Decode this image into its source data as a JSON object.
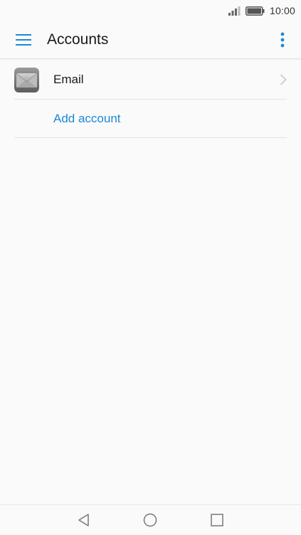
{
  "status_bar": {
    "time": "10:00"
  },
  "app_bar": {
    "title": "Accounts",
    "menu_icon": "hamburger-menu-icon",
    "more_icon": "more-vertical-icon"
  },
  "accounts": {
    "items": [
      {
        "label": "Email",
        "icon": "envelope-icon",
        "trailing_icon": "chevron-right-icon"
      }
    ],
    "add_account_label": "Add account"
  },
  "navigation_bar": {
    "buttons": [
      "back",
      "home",
      "recents"
    ]
  },
  "colors": {
    "accent": "#1e88d6",
    "background": "#fafafa",
    "text": "#1a1a1a"
  }
}
